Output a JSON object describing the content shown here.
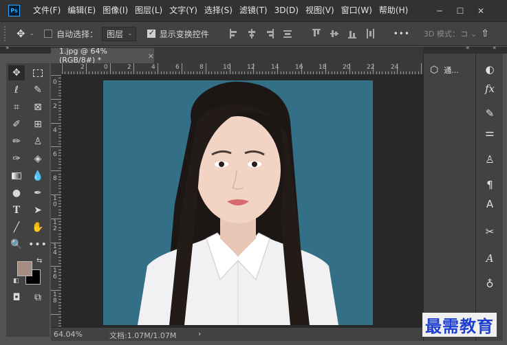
{
  "app": {
    "logo_text": "Ps"
  },
  "menu": [
    "文件(F)",
    "编辑(E)",
    "图像(I)",
    "图层(L)",
    "文字(Y)",
    "选择(S)",
    "滤镜(T)",
    "3D(D)",
    "视图(V)",
    "窗口(W)",
    "帮助(H)"
  ],
  "window_controls": {
    "minimize": "─",
    "maximize": "☐",
    "close": "✕"
  },
  "options_bar": {
    "auto_select_label": "自动选择：",
    "auto_select_checked": false,
    "auto_select_target": "图层",
    "show_transform_label": "显示变换控件",
    "show_transform_checked": true,
    "more": "•••",
    "mode_3d_label": "3D 模式："
  },
  "document": {
    "tab_title": "1.jpg @ 64%(RGB/8#) *",
    "tab_close": "×",
    "zoom": "64.04%",
    "doc_info": "文档:1.07M/1.07M",
    "status_arrow": "›"
  },
  "ruler": {
    "h_labels": [
      "2",
      "0",
      "2",
      "4",
      "6",
      "8",
      "10",
      "12",
      "14",
      "16",
      "18",
      "20",
      "22",
      "24"
    ],
    "v_labels": [
      "0",
      "2",
      "4",
      "6",
      "8",
      "1\n0",
      "1\n2",
      "1\n4",
      "1\n6",
      "1\n8"
    ]
  },
  "panels": {
    "mid_item_label": "通...",
    "collapse_glyph": "«",
    "expand_glyph": "»"
  },
  "watermark": "最需教育",
  "colors": {
    "foreground": "#a58e81",
    "background": "#000000",
    "canvas_bg": "#336f86",
    "accent": "#31a8ff"
  },
  "tools": [
    "move-tool",
    "rectangular-marquee-tool",
    "lasso-tool",
    "quick-selection-tool",
    "crop-tool",
    "frame-tool",
    "eyedropper-tool",
    "spot-healing-tool",
    "brush-tool",
    "clone-stamp-tool",
    "history-brush-tool",
    "eraser-tool",
    "gradient-tool",
    "blur-tool",
    "dodge-tool",
    "pen-tool",
    "type-tool",
    "path-selection-tool",
    "line-tool",
    "hand-tool",
    "zoom-tool",
    "more-tools"
  ]
}
